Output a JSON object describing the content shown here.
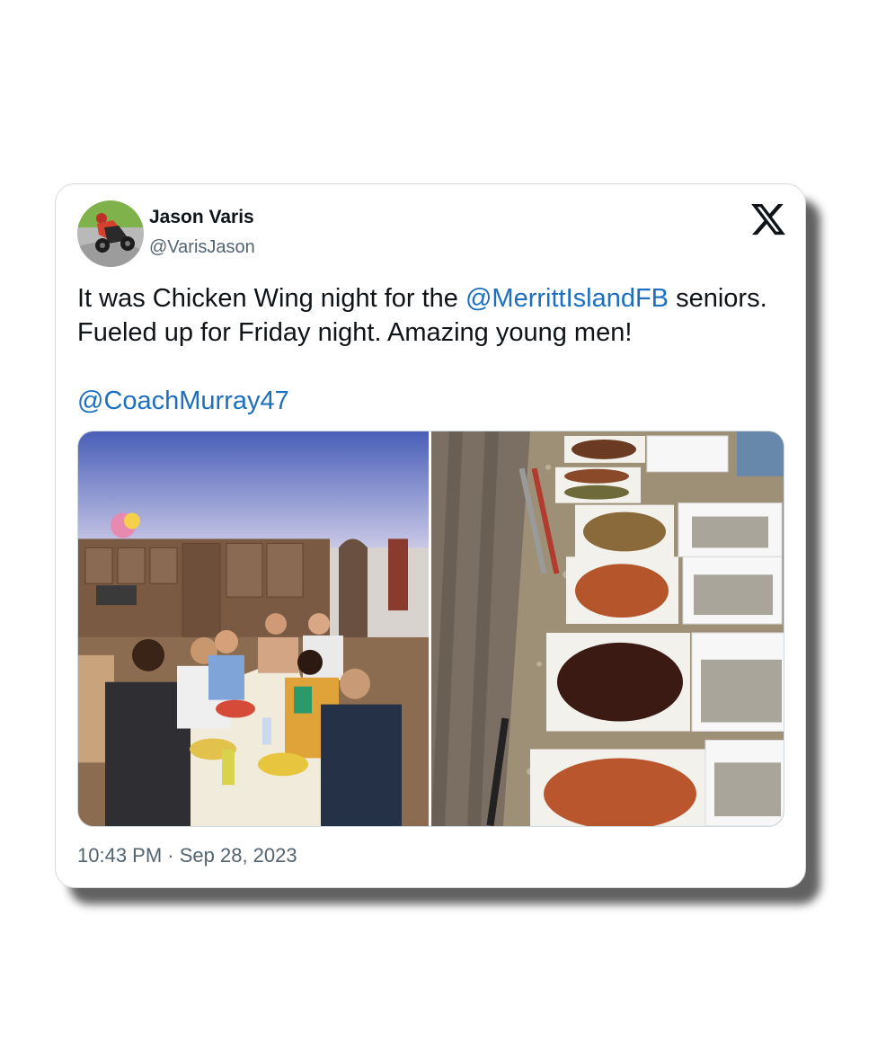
{
  "tweet": {
    "author_name": "Jason Varis",
    "author_handle": "@VarisJason",
    "text_before": "It was Chicken Wing night for the ",
    "mention_1": "@MerrittIslandFB",
    "text_after": " seniors. Fueled up for Friday night.  Amazing young men!",
    "mention_2": "@CoachMurray47",
    "timestamp": "10:43 PM · Sep 28, 2023"
  },
  "icons": {
    "logo": "x-logo-icon"
  },
  "colors": {
    "link": "#1d6fc0",
    "text": "#0f1419",
    "secondary": "#536471"
  }
}
